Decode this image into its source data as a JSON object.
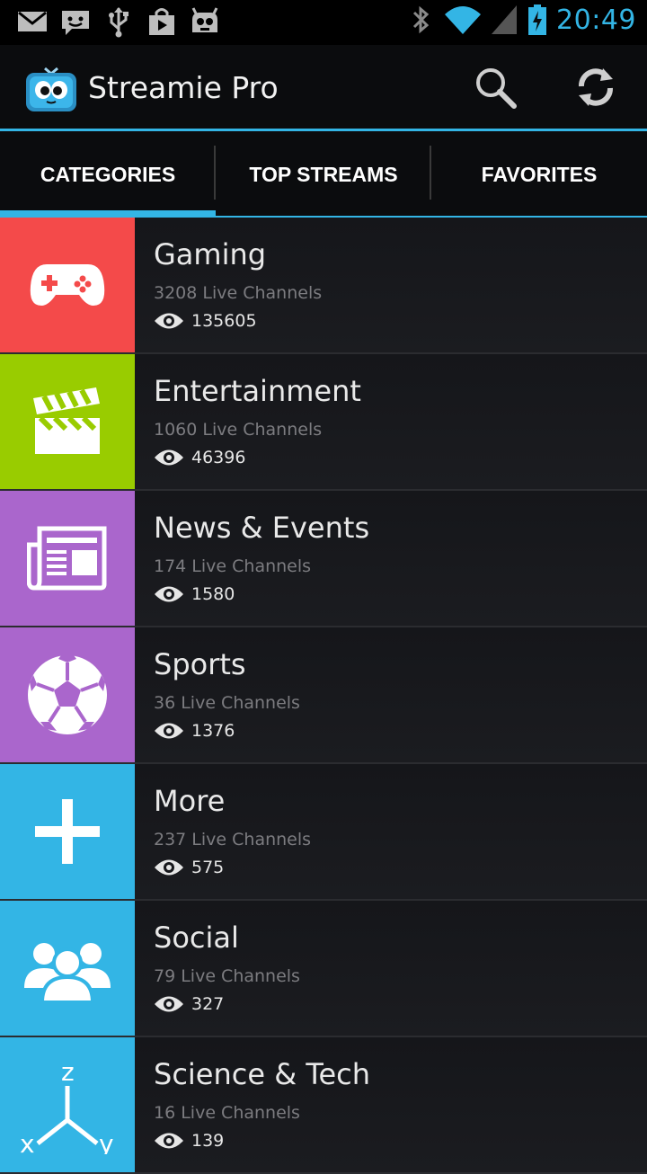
{
  "status_bar": {
    "time": "20:49",
    "icons": [
      "mail-icon",
      "chat-icon",
      "usb-icon",
      "shopping-bag-icon",
      "android-robot-icon",
      "bluetooth-icon",
      "wifi-icon",
      "cellular-signal-icon",
      "battery-charging-icon"
    ]
  },
  "app": {
    "title": "Streamie Pro",
    "actions": [
      "search-icon",
      "refresh-icon"
    ]
  },
  "tabs": [
    {
      "label": "CATEGORIES",
      "active": true
    },
    {
      "label": "TOP STREAMS",
      "active": false
    },
    {
      "label": "FAVORITES",
      "active": false
    }
  ],
  "categories": [
    {
      "name": "Gaming",
      "channels": "3208 Live Channels",
      "viewers": "135605",
      "color": "#f44a4a",
      "icon": "gamepad-icon"
    },
    {
      "name": "Entertainment",
      "channels": "1060 Live Channels",
      "viewers": "46396",
      "color": "#99cc00",
      "icon": "clapperboard-icon"
    },
    {
      "name": "News & Events",
      "channels": "174 Live Channels",
      "viewers": "1580",
      "color": "#aa66cc",
      "icon": "newspaper-icon"
    },
    {
      "name": "Sports",
      "channels": "36 Live Channels",
      "viewers": "1376",
      "color": "#aa66cc",
      "icon": "soccer-ball-icon"
    },
    {
      "name": "More",
      "channels": "237 Live Channels",
      "viewers": "575",
      "color": "#33b5e5",
      "icon": "plus-icon"
    },
    {
      "name": "Social",
      "channels": "79 Live Channels",
      "viewers": "327",
      "color": "#33b5e5",
      "icon": "people-icon"
    },
    {
      "name": "Science & Tech",
      "channels": "16 Live Channels",
      "viewers": "139",
      "color": "#33b5e5",
      "icon": "xyz-axes-icon"
    }
  ]
}
